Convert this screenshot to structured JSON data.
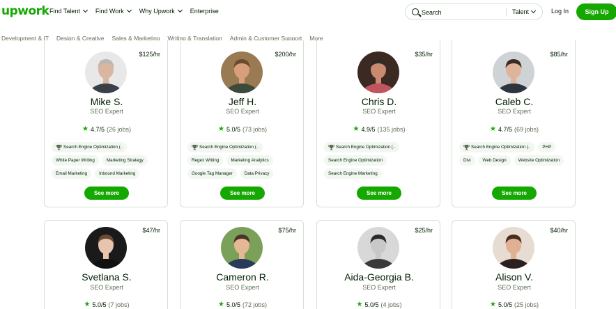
{
  "header": {
    "logo": "upwork",
    "nav": [
      "Find Talent",
      "Find Work",
      "Why Upwork",
      "Enterprise"
    ],
    "search_placeholder": "Search",
    "search_scope": "Talent",
    "login": "Log In",
    "signup": "Sign Up"
  },
  "categories": [
    "Development & IT",
    "Design & Creative",
    "Sales & Marketing",
    "Writing & Translation",
    "Admin & Customer Support",
    "More"
  ],
  "see_more_label": "See more",
  "freelancers": [
    {
      "name": "Mike S.",
      "title": "SEO Expert",
      "rate": "$125/hr",
      "score": "4.7/5",
      "jobs": "(26 jobs)",
      "skills": [
        {
          "label": "Search Engine Optimization (..",
          "badge": true
        },
        {
          "label": "White Paper Writing"
        },
        {
          "label": "Marketing Strategy"
        },
        {
          "label": "Email Marketing"
        },
        {
          "label": "Inbound Marketing"
        }
      ],
      "avatar_bg": "#e8e8e8",
      "avatar_skin": "#d9b6a0",
      "avatar_hair": "#bdb6ae",
      "avatar_shirt": "#3a4048"
    },
    {
      "name": "Jeff H.",
      "title": "SEO Expert",
      "rate": "$200/hr",
      "score": "5.0/5",
      "jobs": "(73 jobs)",
      "skills": [
        {
          "label": "Search Engine Optimization (..",
          "badge": true
        },
        {
          "label": "Regex Writing"
        },
        {
          "label": "Marketing Analytics"
        },
        {
          "label": "Google Tag Manager"
        },
        {
          "label": "Data Privacy"
        }
      ],
      "avatar_bg": "#9a7a52",
      "avatar_skin": "#d8a07a",
      "avatar_hair": "#6b4a2e",
      "avatar_shirt": "#3b4a3a"
    },
    {
      "name": "Chris D.",
      "title": "SEO Expert",
      "rate": "$35/hr",
      "score": "4.9/5",
      "jobs": "(135 jobs)",
      "skills": [
        {
          "label": "Search Engine Optimization (..",
          "badge": true
        },
        {
          "label": "Search Engine Optimization"
        },
        {
          "label": "Search Engine Marketing"
        }
      ],
      "avatar_bg": "#3a2a22",
      "avatar_skin": "#c98a70",
      "avatar_hair": "#2e2a28",
      "avatar_shirt": "#c05560"
    },
    {
      "name": "Caleb C.",
      "title": "SEO Expert",
      "rate": "$85/hr",
      "score": "4.7/5",
      "jobs": "(69 jobs)",
      "skills": [
        {
          "label": "Search Engine Optimization (..",
          "badge": true
        },
        {
          "label": "PHP"
        },
        {
          "label": "Divi"
        },
        {
          "label": "Web Design"
        },
        {
          "label": "Website Optimization"
        }
      ],
      "avatar_bg": "#cfd3d6",
      "avatar_skin": "#e0b49a",
      "avatar_hair": "#3a2c22",
      "avatar_shirt": "#2c3440"
    },
    {
      "name": "Svetlana S.",
      "title": "SEO Expert",
      "rate": "$47/hr",
      "score": "5.0/5",
      "jobs": "(7 jobs)",
      "skills": [],
      "avatar_bg": "#1a1a1a",
      "avatar_skin": "#e8c3ad",
      "avatar_hair": "#6a4a34",
      "avatar_shirt": "#111111"
    },
    {
      "name": "Cameron R.",
      "title": "SEO Expert",
      "rate": "$75/hr",
      "score": "5.0/5",
      "jobs": "(72 jobs)",
      "skills": [],
      "avatar_bg": "#7aa05a",
      "avatar_skin": "#e4b894",
      "avatar_hair": "#4a3424",
      "avatar_shirt": "#2a3a5a"
    },
    {
      "name": "Aida-Georgia B.",
      "title": "SEO Expert",
      "rate": "$25/hr",
      "score": "5.0/5",
      "jobs": "(4 jobs)",
      "skills": [],
      "avatar_bg": "#d8d8d8",
      "avatar_skin": "#c8c8c8",
      "avatar_hair": "#2a2a2a",
      "avatar_shirt": "#3a3a3a"
    },
    {
      "name": "Alison V.",
      "title": "SEO Expert",
      "rate": "$40/hr",
      "score": "5.0/5",
      "jobs": "(25 jobs)",
      "skills": [],
      "avatar_bg": "#e6dcd2",
      "avatar_skin": "#e0b092",
      "avatar_hair": "#4a2a1c",
      "avatar_shirt": "#2a2020"
    }
  ],
  "colors": {
    "brand": "#14a800",
    "text": "#001e00",
    "muted": "#5e6d55",
    "border": "#d5e0d5"
  }
}
